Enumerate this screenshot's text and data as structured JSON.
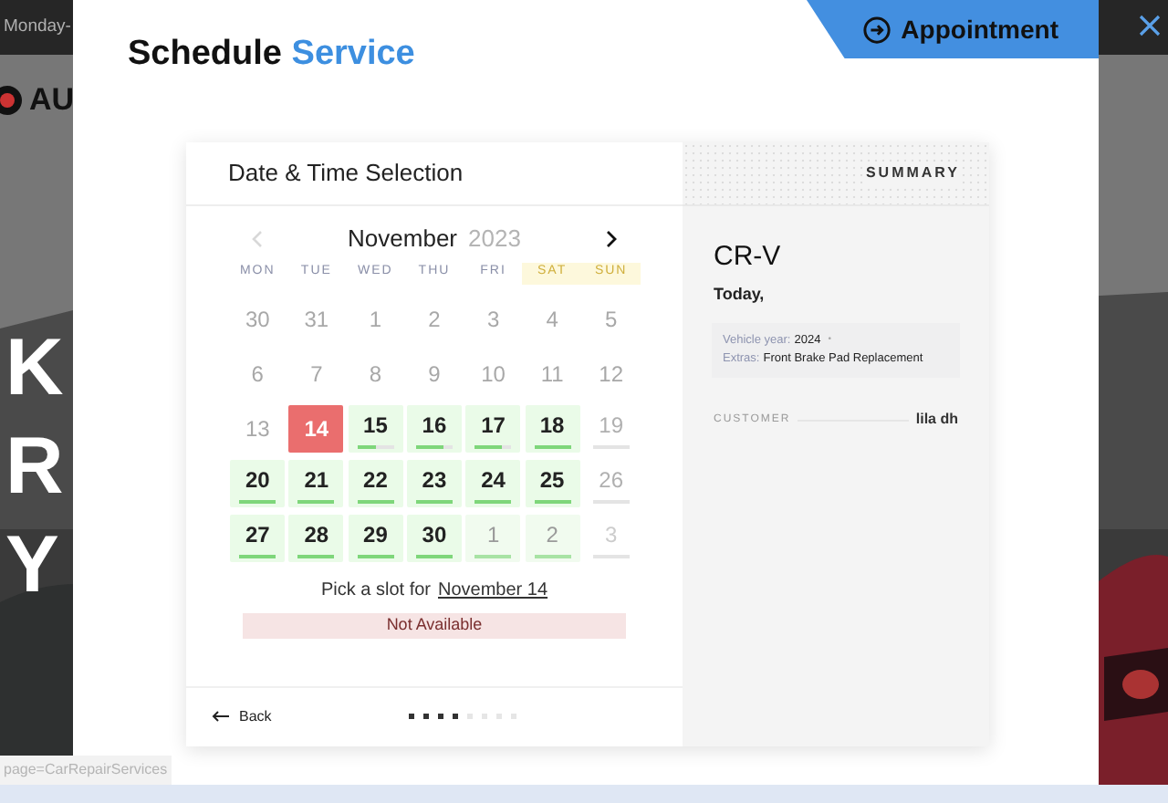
{
  "background": {
    "top_bar_text": "Monday-",
    "logo_text": "AU",
    "hero_lines": [
      "K",
      "R",
      "Y"
    ],
    "status_url": "page=CarRepairServices"
  },
  "appointment_tab": {
    "label": "Appointment"
  },
  "modal": {
    "title": "Schedule",
    "title_accent": "Service"
  },
  "calendar": {
    "heading": "Date & Time Selection",
    "month": "November",
    "year": "2023",
    "prev_disabled": true,
    "weekdays": [
      {
        "label": "MON",
        "weekend": false
      },
      {
        "label": "TUE",
        "weekend": false
      },
      {
        "label": "WED",
        "weekend": false
      },
      {
        "label": "THU",
        "weekend": false
      },
      {
        "label": "FRI",
        "weekend": false
      },
      {
        "label": "SAT",
        "weekend": true
      },
      {
        "label": "SUN",
        "weekend": true
      }
    ],
    "days": [
      {
        "day": "30",
        "kind": "past"
      },
      {
        "day": "31",
        "kind": "past"
      },
      {
        "day": "1",
        "kind": "past"
      },
      {
        "day": "2",
        "kind": "past"
      },
      {
        "day": "3",
        "kind": "past"
      },
      {
        "day": "4",
        "kind": "past"
      },
      {
        "day": "5",
        "kind": "past"
      },
      {
        "day": "6",
        "kind": "past"
      },
      {
        "day": "7",
        "kind": "past"
      },
      {
        "day": "8",
        "kind": "past"
      },
      {
        "day": "9",
        "kind": "past"
      },
      {
        "day": "10",
        "kind": "past"
      },
      {
        "day": "11",
        "kind": "past"
      },
      {
        "day": "12",
        "kind": "past"
      },
      {
        "day": "13",
        "kind": "past"
      },
      {
        "day": "14",
        "kind": "selected"
      },
      {
        "day": "15",
        "kind": "open",
        "level": 0.5
      },
      {
        "day": "16",
        "kind": "open",
        "level": 0.75
      },
      {
        "day": "17",
        "kind": "open",
        "level": 0.75
      },
      {
        "day": "18",
        "kind": "open",
        "level": 1
      },
      {
        "day": "19",
        "kind": "closed"
      },
      {
        "day": "20",
        "kind": "open",
        "level": 1
      },
      {
        "day": "21",
        "kind": "open",
        "level": 1
      },
      {
        "day": "22",
        "kind": "open",
        "level": 1
      },
      {
        "day": "23",
        "kind": "open",
        "level": 1
      },
      {
        "day": "24",
        "kind": "open",
        "level": 1
      },
      {
        "day": "25",
        "kind": "open",
        "level": 1
      },
      {
        "day": "26",
        "kind": "closed"
      },
      {
        "day": "27",
        "kind": "open",
        "level": 1
      },
      {
        "day": "28",
        "kind": "open",
        "level": 1
      },
      {
        "day": "29",
        "kind": "open",
        "level": 1
      },
      {
        "day": "30",
        "kind": "open",
        "level": 1
      },
      {
        "day": "1",
        "kind": "next_open",
        "level": 1
      },
      {
        "day": "2",
        "kind": "next_open",
        "level": 1
      },
      {
        "day": "3",
        "kind": "next_closed"
      }
    ],
    "slot_prompt": "Pick a slot for",
    "slot_date": "November 14",
    "availability": "Not Available",
    "back": "Back",
    "steps": [
      {
        "done": true
      },
      {
        "done": true
      },
      {
        "done": true
      },
      {
        "done": true
      },
      {
        "done": false
      },
      {
        "done": false
      },
      {
        "done": false
      },
      {
        "done": false
      }
    ]
  },
  "summary": {
    "heading": "SUMMARY",
    "model": "CR-V",
    "when": "Today,",
    "details": [
      {
        "label": "Vehicle year:",
        "value": "2024",
        "separator": "•"
      },
      {
        "label": "Extras:",
        "value": "Front Brake Pad Replacement"
      }
    ],
    "customer_label": "CUSTOMER",
    "customer_value": "lila dh"
  }
}
